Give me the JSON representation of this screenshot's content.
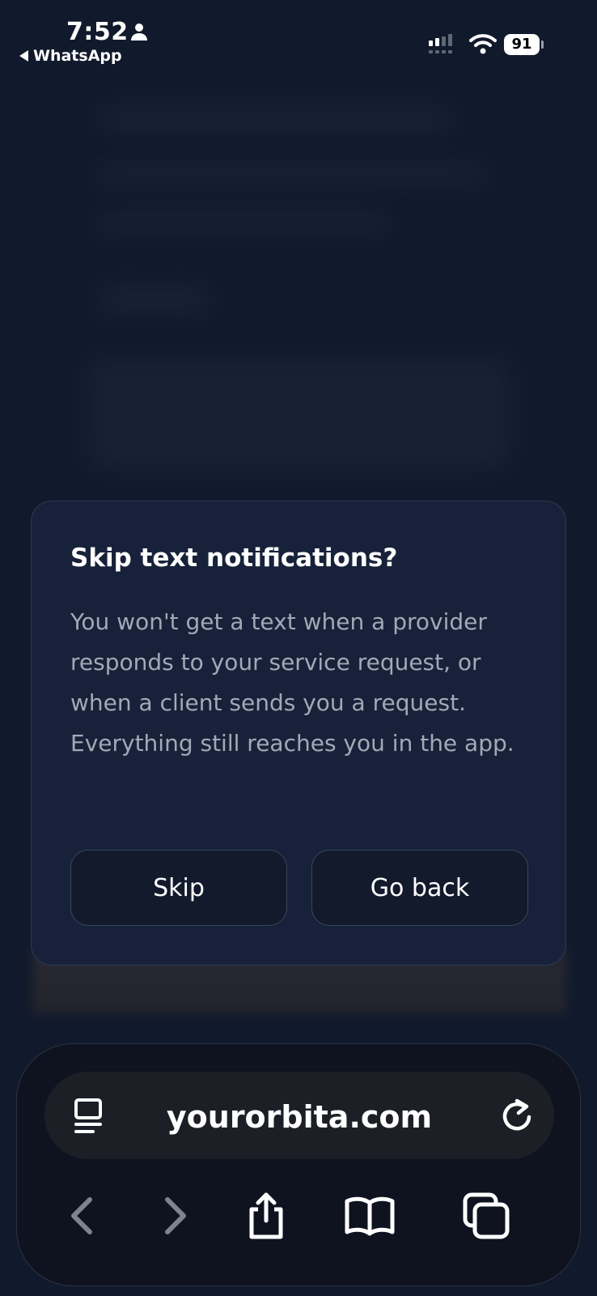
{
  "status_bar": {
    "time": "7:52",
    "back_app_label": "WhatsApp",
    "battery_level": "91"
  },
  "dialog": {
    "title": "Skip text notifications?",
    "body": "You won't get a text when a provider responds to your service request, or when a client sends you a request. Everything still reaches you in the app.",
    "skip_label": "Skip",
    "go_back_label": "Go back"
  },
  "browser": {
    "url": "yourorbita.com",
    "icons": [
      "reader-icon",
      "reload-icon",
      "back-arrow-icon",
      "forward-arrow-icon",
      "share-icon",
      "bookmarks-icon",
      "tabs-icon"
    ]
  },
  "colors": {
    "background": "#111a2c",
    "dialog_bg": "#17223a",
    "body_text": "#a2a9b6"
  }
}
